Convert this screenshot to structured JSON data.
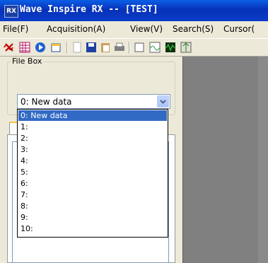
{
  "window": {
    "app_icon_text": "RX",
    "title": "Wave Inspire RX -- [TEST]"
  },
  "menu": [
    "File(F)",
    "Acquisition(A)",
    "View(V)",
    "Search(S)",
    "Cursor("
  ],
  "toolbar": {
    "icons": [
      "delete-waveform-icon",
      "grid-icon",
      "run-icon",
      "new-folder-icon",
      "page-icon",
      "save-icon",
      "clipboard-icon",
      "print-icon",
      "empty-square-icon",
      "wave-icon",
      "green-wave-icon",
      "cursor-marker-icon"
    ]
  },
  "file_box": {
    "label": "File Box",
    "selected_value": "0: New data",
    "options": [
      "0: New data",
      "1:",
      "2:",
      "3:",
      "4:",
      "5:",
      "6:",
      "7:",
      "8:",
      "9:",
      "10:"
    ],
    "selected_index": 0
  },
  "colors": {
    "title_bar": "#0a3dc8",
    "selection": "#316ac5",
    "workspace": "#808080",
    "tab_accent": "#ffc83c"
  }
}
